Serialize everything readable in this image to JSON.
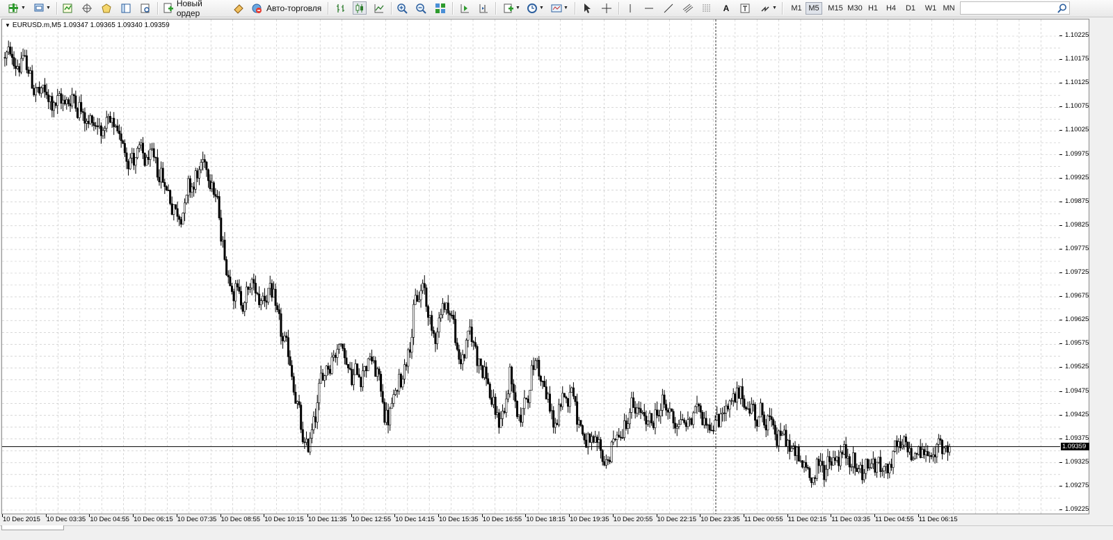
{
  "toolbar": {
    "new_order_label": "Новый ордер",
    "autotrading_label": "Авто-торговля",
    "icons": [
      "new-chart-icon",
      "profiles-icon",
      "market-watch-icon",
      "navigator-icon",
      "data-window-icon",
      "terminal-icon",
      "strategy-tester-icon",
      "new-order-icon",
      "metaeditor-icon",
      "autotrading-icon",
      "bar-chart-icon",
      "candlestick-icon",
      "line-chart-icon",
      "zoom-in-icon",
      "zoom-out-icon",
      "tile-windows-icon",
      "auto-scroll-icon",
      "chart-shift-icon",
      "indicators-icon",
      "periods-icon",
      "templates-icon",
      "cursor-icon",
      "crosshair-icon",
      "vertical-line-icon",
      "horizontal-line-icon",
      "trendline-icon",
      "equidistant-channel-icon",
      "fibonacci-icon",
      "text-icon",
      "text-label-icon",
      "arrows-icon",
      "search-icon"
    ],
    "timeframes": [
      "M1",
      "M5",
      "M15",
      "M30",
      "H1",
      "H4",
      "D1",
      "W1",
      "MN"
    ],
    "active_timeframe": "M5"
  },
  "chart": {
    "symbol_info": "EURUSD.m,M5  1.09347 1.09365 1.09340 1.09359",
    "bid_price_badge": "1.09359",
    "colors": {
      "background": "#ffffff",
      "grid": "#c0c0c0",
      "candle": "#000000",
      "bid_line": "#000000"
    }
  },
  "chart_data": {
    "type": "candlestick",
    "symbol": "EURUSD.m",
    "timeframe": "M5",
    "last_bar": {
      "open": 1.09347,
      "high": 1.09365,
      "low": 1.0934,
      "close": 1.09359
    },
    "bid": 1.09359,
    "ylim": [
      1.092,
      1.1025
    ],
    "y_ticks": [
      "1.10225",
      "1.10175",
      "1.10125",
      "1.10075",
      "1.10025",
      "1.09975",
      "1.09925",
      "1.09875",
      "1.09825",
      "1.09775",
      "1.09725",
      "1.09675",
      "1.09625",
      "1.09575",
      "1.09525",
      "1.09475",
      "1.09425",
      "1.09375",
      "1.09325",
      "1.09275",
      "1.09225"
    ],
    "x_ticks": [
      "10 Dec 2015",
      "10 Dec 03:35",
      "10 Dec 04:55",
      "10 Dec 06:15",
      "10 Dec 07:35",
      "10 Dec 08:55",
      "10 Dec 10:15",
      "10 Dec 11:35",
      "10 Dec 12:55",
      "10 Dec 14:15",
      "10 Dec 15:35",
      "10 Dec 16:55",
      "10 Dec 18:15",
      "10 Dec 19:35",
      "10 Dec 20:55",
      "10 Dec 22:15",
      "10 Dec 23:35",
      "11 Dec 00:55",
      "11 Dec 02:15",
      "11 Dec 03:35",
      "11 Dec 04:55",
      "11 Dec 06:15"
    ],
    "grid": true,
    "price_path": [
      [
        0,
        1.1018
      ],
      [
        10,
        1.1017
      ],
      [
        18,
        1.101
      ],
      [
        25,
        1.1009
      ],
      [
        30,
        1.1008
      ],
      [
        38,
        1.101
      ],
      [
        45,
        1.1005
      ],
      [
        55,
        1.1003
      ],
      [
        62,
        1.1001
      ],
      [
        70,
        1.0997
      ],
      [
        78,
        1.0996
      ],
      [
        85,
        1.0994
      ],
      [
        90,
        1.0989
      ],
      [
        95,
        1.0984
      ],
      [
        100,
        1.099
      ],
      [
        105,
        1.0993
      ],
      [
        110,
        1.0995
      ],
      [
        113,
        1.0994
      ],
      [
        117,
        1.0985
      ],
      [
        120,
        1.0976
      ],
      [
        125,
        1.097
      ],
      [
        128,
        1.097
      ],
      [
        130,
        1.0965
      ],
      [
        135,
        1.097
      ],
      [
        140,
        1.0967
      ],
      [
        145,
        1.097
      ],
      [
        150,
        1.0961
      ],
      [
        155,
        1.0955
      ],
      [
        158,
        1.095
      ],
      [
        162,
        1.094
      ],
      [
        165,
        1.0933
      ],
      [
        170,
        1.0943
      ],
      [
        175,
        1.0952
      ],
      [
        180,
        1.0956
      ],
      [
        185,
        1.0958
      ],
      [
        190,
        1.095
      ],
      [
        195,
        1.0952
      ],
      [
        200,
        1.0955
      ],
      [
        205,
        1.095
      ],
      [
        210,
        1.0941
      ],
      [
        215,
        1.0947
      ],
      [
        220,
        1.0955
      ],
      [
        225,
        1.0965
      ],
      [
        230,
        1.097
      ],
      [
        235,
        1.0958
      ],
      [
        240,
        1.0966
      ],
      [
        245,
        1.0965
      ],
      [
        250,
        1.0952
      ],
      [
        255,
        1.096
      ],
      [
        260,
        1.0955
      ],
      [
        265,
        1.095
      ],
      [
        270,
        1.094
      ],
      [
        275,
        1.0945
      ],
      [
        278,
        1.0952
      ],
      [
        282,
        1.094
      ],
      [
        287,
        1.0948
      ],
      [
        292,
        1.0955
      ],
      [
        297,
        1.0947
      ],
      [
        302,
        1.094
      ],
      [
        307,
        1.0945
      ],
      [
        312,
        1.095
      ],
      [
        315,
        1.0942
      ],
      [
        320,
        1.0936
      ],
      [
        325,
        1.0934
      ],
      [
        330,
        1.0933
      ],
      [
        335,
        1.0937
      ],
      [
        340,
        1.094
      ],
      [
        345,
        1.0944
      ],
      [
        350,
        1.0942
      ],
      [
        355,
        1.094
      ],
      [
        360,
        1.0945
      ],
      [
        365,
        1.0943
      ],
      [
        370,
        1.0942
      ],
      [
        375,
        1.094
      ],
      [
        380,
        1.0944
      ],
      [
        385,
        1.0943
      ],
      [
        390,
        1.094
      ],
      [
        395,
        1.0944
      ],
      [
        400,
        1.0945
      ],
      [
        405,
        1.0946
      ],
      [
        410,
        1.0944
      ],
      [
        415,
        1.0943
      ],
      [
        420,
        1.0941
      ],
      [
        425,
        1.0938
      ],
      [
        430,
        1.0937
      ],
      [
        435,
        1.0933
      ],
      [
        440,
        1.0931
      ],
      [
        445,
        1.093
      ],
      [
        450,
        1.0932
      ],
      [
        455,
        1.0933
      ],
      [
        460,
        1.0934
      ],
      [
        465,
        1.0933
      ],
      [
        470,
        1.0931
      ],
      [
        475,
        1.0932
      ],
      [
        480,
        1.0931
      ],
      [
        485,
        1.0932
      ],
      [
        490,
        1.0934
      ],
      [
        495,
        1.0935
      ],
      [
        500,
        1.0935
      ],
      [
        505,
        1.0935
      ],
      [
        510,
        1.0934
      ],
      [
        515,
        1.0935
      ],
      [
        520,
        1.0936
      ]
    ],
    "bar_count": 521
  }
}
